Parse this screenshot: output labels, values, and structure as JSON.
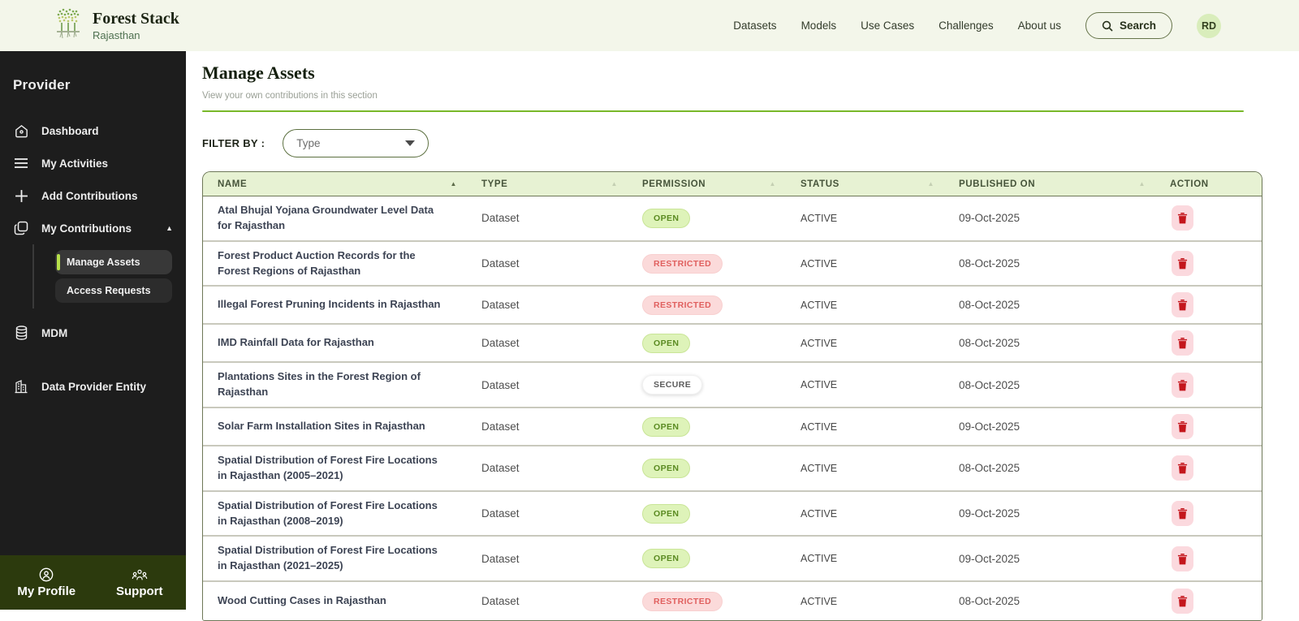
{
  "brand": {
    "name": "Forest Stack",
    "region": "Rajasthan"
  },
  "topnav": {
    "items": [
      "Datasets",
      "Models",
      "Use Cases",
      "Challenges",
      "About us"
    ],
    "search_label": "Search",
    "avatar_initials": "RD"
  },
  "sidebar": {
    "role_label": "Provider",
    "items": [
      {
        "label": "Dashboard",
        "icon": "home-icon"
      },
      {
        "label": "My Activities",
        "icon": "list-icon"
      },
      {
        "label": "Add Contributions",
        "icon": "plus-icon"
      },
      {
        "label": "My Contributions",
        "icon": "copy-icon",
        "expanded": true,
        "children": [
          {
            "label": "Manage Assets",
            "active": true
          },
          {
            "label": "Access Requests",
            "active": false
          }
        ]
      },
      {
        "label": "MDM",
        "icon": "database-icon"
      },
      {
        "label": "Data Provider Entity",
        "icon": "building-icon"
      }
    ],
    "footer": [
      {
        "label": "My Profile",
        "icon": "profile-icon"
      },
      {
        "label": "Support",
        "icon": "support-icon"
      }
    ]
  },
  "main": {
    "title": "Manage Assets",
    "subtitle": "View your own contributions in this section",
    "filter_label": "FILTER BY :",
    "filter_value": "Type",
    "table": {
      "columns": [
        {
          "label": "NAME",
          "has_caret": true,
          "sort_active": true
        },
        {
          "label": "TYPE",
          "has_caret": true,
          "sort_active": false
        },
        {
          "label": "PERMISSION",
          "has_caret": true,
          "sort_active": false
        },
        {
          "label": "STATUS",
          "has_caret": true,
          "sort_active": false
        },
        {
          "label": "PUBLISHED ON",
          "has_caret": true,
          "sort_active": false
        },
        {
          "label": "ACTION",
          "has_caret": false,
          "sort_active": false
        }
      ],
      "rows": [
        {
          "name": "Atal Bhujal Yojana Groundwater Level Data for Rajasthan",
          "type": "Dataset",
          "permission": "OPEN",
          "status": "ACTIVE",
          "published": "09-Oct-2025"
        },
        {
          "name": "Forest Product Auction Records for the Forest Regions of Rajasthan",
          "type": "Dataset",
          "permission": "RESTRICTED",
          "status": "ACTIVE",
          "published": "08-Oct-2025"
        },
        {
          "name": "Illegal Forest Pruning Incidents in Rajasthan",
          "type": "Dataset",
          "permission": "RESTRICTED",
          "status": "ACTIVE",
          "published": "08-Oct-2025"
        },
        {
          "name": "IMD Rainfall Data for Rajasthan",
          "type": "Dataset",
          "permission": "OPEN",
          "status": "ACTIVE",
          "published": "08-Oct-2025"
        },
        {
          "name": "Plantations Sites in the Forest Region of Rajasthan",
          "type": "Dataset",
          "permission": "SECURE",
          "status": "ACTIVE",
          "published": "08-Oct-2025"
        },
        {
          "name": "Solar Farm Installation Sites in Rajasthan",
          "type": "Dataset",
          "permission": "OPEN",
          "status": "ACTIVE",
          "published": "09-Oct-2025"
        },
        {
          "name": "Spatial Distribution of Forest Fire Locations in Rajasthan (2005–2021)",
          "type": "Dataset",
          "permission": "OPEN",
          "status": "ACTIVE",
          "published": "08-Oct-2025"
        },
        {
          "name": "Spatial Distribution of Forest Fire Locations in Rajasthan (2008–2019)",
          "type": "Dataset",
          "permission": "OPEN",
          "status": "ACTIVE",
          "published": "09-Oct-2025"
        },
        {
          "name": "Spatial Distribution of Forest Fire Locations in Rajasthan (2021–2025)",
          "type": "Dataset",
          "permission": "OPEN",
          "status": "ACTIVE",
          "published": "09-Oct-2025"
        },
        {
          "name": "Wood Cutting Cases in Rajasthan",
          "type": "Dataset",
          "permission": "RESTRICTED",
          "status": "ACTIVE",
          "published": "08-Oct-2025"
        }
      ]
    }
  },
  "colors": {
    "topbar_bg": "#f3f6ea",
    "sidebar_bg": "#1d1d1d",
    "sidebar_footer_bg": "#2c3a0d",
    "accent_green": "#79b829",
    "active_indicator": "#b7e04a",
    "table_header_bg": "#e7f2d3",
    "table_border": "#6e7858",
    "badge_open_bg": "#def3b9",
    "badge_open_text": "#5a8a21",
    "badge_restricted_bg": "#fbdada",
    "badge_restricted_text": "#e0605f",
    "badge_secure_bg": "#ffffff",
    "badge_secure_text": "#5c5c5c",
    "delete_btn_bg": "#fbd9de",
    "delete_icon": "#c4161c"
  }
}
